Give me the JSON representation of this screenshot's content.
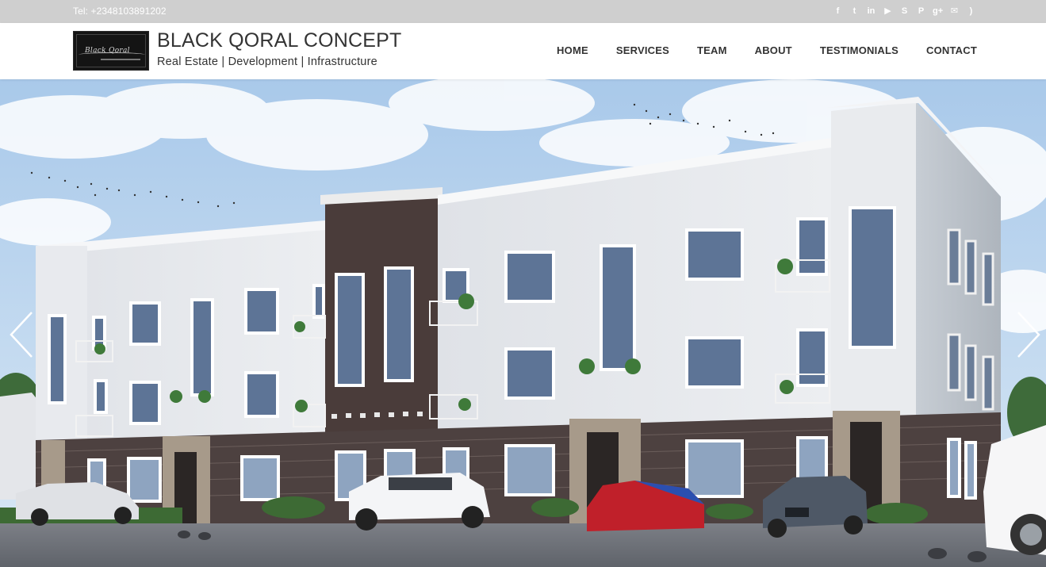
{
  "topbar": {
    "phone": "Tel: +2348103891202",
    "social": [
      {
        "icon": "facebook-icon",
        "glyph": "f"
      },
      {
        "icon": "twitter-icon",
        "glyph": "t"
      },
      {
        "icon": "linkedin-icon",
        "glyph": "in"
      },
      {
        "icon": "youtube-icon",
        "glyph": "▶"
      },
      {
        "icon": "skype-icon",
        "glyph": "S"
      },
      {
        "icon": "pinterest-icon",
        "glyph": "P"
      },
      {
        "icon": "google-plus-icon",
        "glyph": "g+"
      },
      {
        "icon": "envelope-icon",
        "glyph": "✉"
      },
      {
        "icon": "rss-icon",
        "glyph": ")"
      }
    ]
  },
  "header": {
    "logo_text": "Black Qoral",
    "title": "BLACK QORAL CONCEPT",
    "tagline": "Real Estate | Development | Infrastructure"
  },
  "nav": {
    "home": "HOME",
    "services": "SERVICES",
    "team": "TEAM",
    "about": "ABOUT",
    "testimonials": "TESTIMONIALS",
    "contact": "CONTACT"
  },
  "hero": {
    "image": "building-rendering-slide",
    "prev_icon": "chevron-left-icon",
    "next_icon": "chevron-right-icon"
  },
  "colors": {
    "topbar_bg": "#cfcfcf",
    "text_dark": "#333333",
    "building_white": "#e6e8ec",
    "building_brown": "#4a3c3a",
    "sky": "#b9d5ee"
  }
}
